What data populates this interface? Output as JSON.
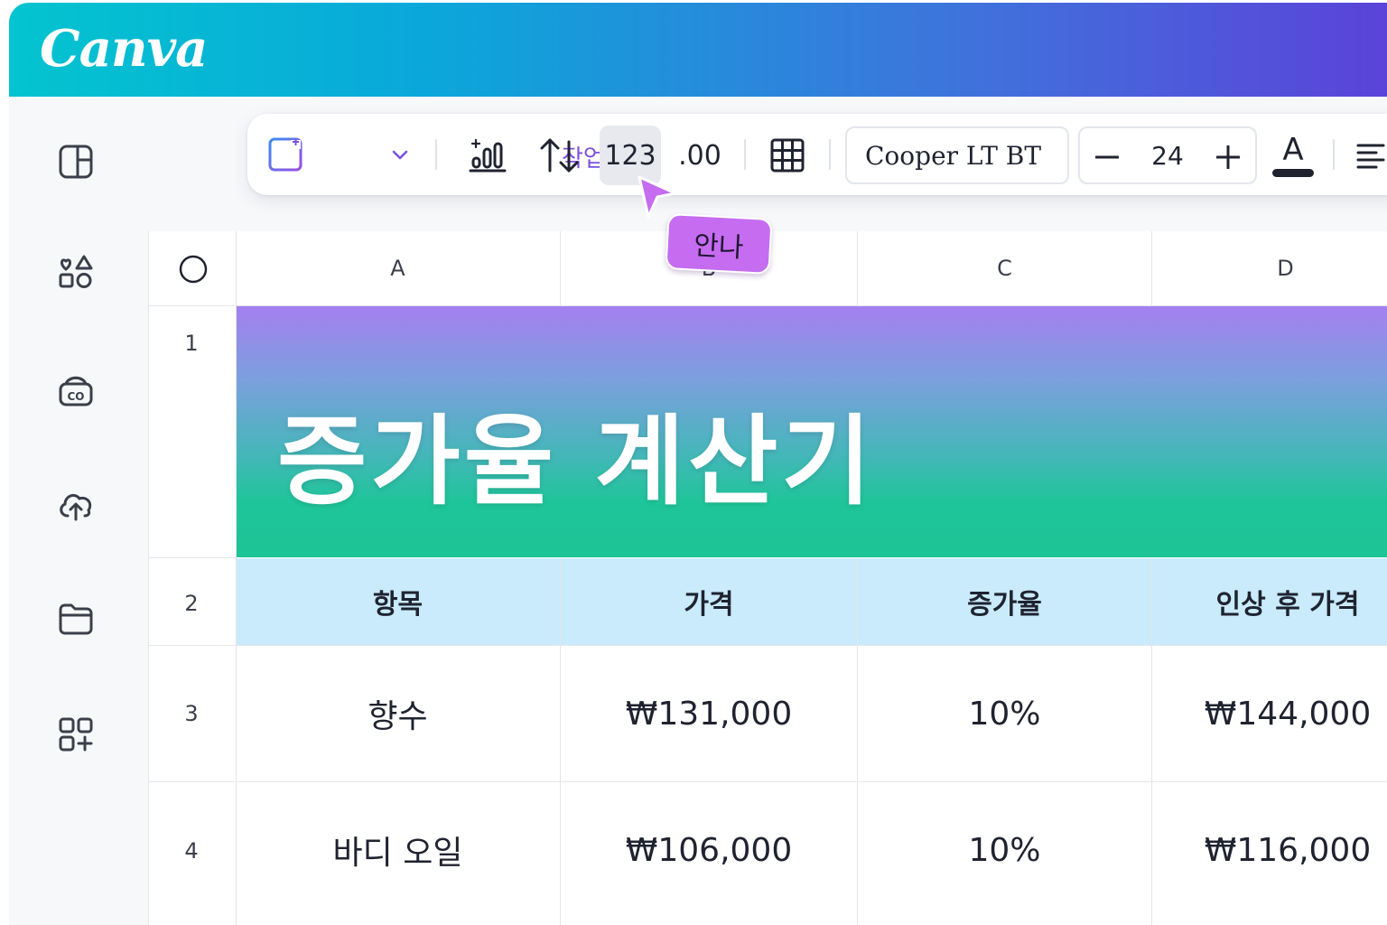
{
  "app": {
    "logo": "Canva"
  },
  "toolbar": {
    "action_label": "작업",
    "number_format": "123",
    "decimal_format": ".00",
    "font_name": "Cooper LT BT",
    "font_size": "24",
    "text_color_glyph": "A"
  },
  "columns": [
    "A",
    "B",
    "C",
    "D"
  ],
  "rows": [
    "1",
    "2",
    "3",
    "4"
  ],
  "sheet": {
    "title": "증가율 계산기",
    "headers": [
      "항목",
      "가격",
      "증가율",
      "인상 후 가격"
    ],
    "data": [
      [
        "향수",
        "₩131,000",
        "10%",
        "₩144,000"
      ],
      [
        "바디 오일",
        "₩106,000",
        "10%",
        "₩116,000"
      ]
    ]
  },
  "collaborator": {
    "name": "안나",
    "color": "#c56cf1"
  },
  "colors": {
    "header_band": "#c9ebfb",
    "accent": "#7b4fe0",
    "title_gradient_top": "#a57ff0",
    "title_gradient_bottom": "#1dc495"
  }
}
